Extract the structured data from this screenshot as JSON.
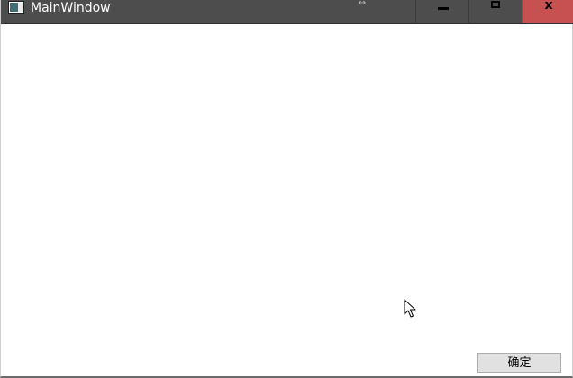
{
  "window": {
    "title": "MainWindow",
    "icon": "window-app-icon",
    "resize_indicator": "↔",
    "controls": {
      "minimize_icon": "minimize-icon",
      "maximize_icon": "maximize-icon",
      "close_icon": "close-icon",
      "close_label": "x"
    }
  },
  "content": {
    "confirm_button_label": "确定"
  },
  "colors": {
    "titlebar": "#4d4d4d",
    "close_button": "#c75050",
    "background": "#ffffff",
    "button_face": "#e1e1e1"
  }
}
